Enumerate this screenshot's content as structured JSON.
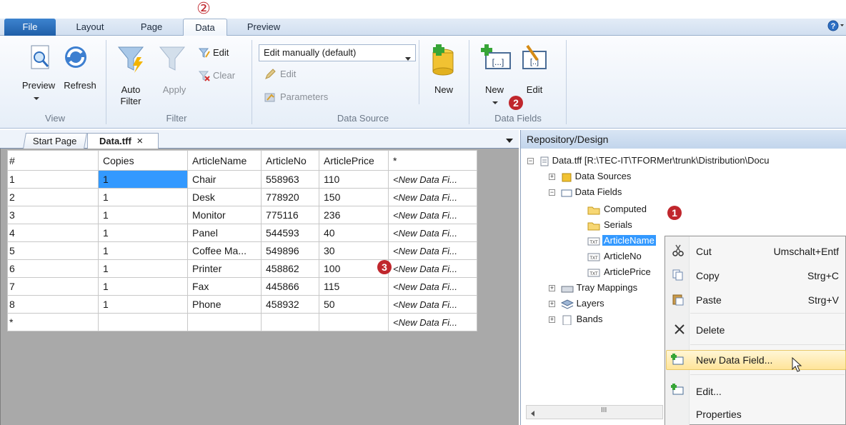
{
  "ribbon_tabs": {
    "file": "File",
    "layout": "Layout",
    "page": "Page",
    "data": "Data",
    "preview": "Preview"
  },
  "callouts": {
    "one": "1",
    "two": "2",
    "three": "3",
    "two_top": "②"
  },
  "groups": {
    "view": {
      "label": "View",
      "preview": "Preview",
      "refresh": "Refresh"
    },
    "filter": {
      "label": "Filter",
      "auto": "Auto",
      "auto2": "Filter",
      "apply": "Apply",
      "edit": "Edit",
      "clear": "Clear"
    },
    "datasource": {
      "label": "Data Source",
      "dropdown": "Edit manually (default)",
      "edit": "Edit",
      "parameters": "Parameters",
      "new": "New"
    },
    "datafields": {
      "label": "Data Fields",
      "new": "New",
      "edit": "Edit"
    }
  },
  "doc_tabs": {
    "start": "Start Page",
    "data": "Data.tff",
    "close": "×"
  },
  "grid": {
    "headers": [
      "#",
      "Copies",
      "ArticleName",
      "ArticleNo",
      "ArticlePrice",
      "*"
    ],
    "rows": [
      [
        "1",
        "1",
        "Chair",
        "558963",
        "110",
        "<New Data Fi..."
      ],
      [
        "2",
        "1",
        "Desk",
        "778920",
        "150",
        "<New Data Fi..."
      ],
      [
        "3",
        "1",
        "Monitor",
        "775116",
        "236",
        "<New Data Fi..."
      ],
      [
        "4",
        "1",
        "Panel",
        "544593",
        "40",
        "<New Data Fi..."
      ],
      [
        "5",
        "1",
        "Coffee Ma...",
        "549896",
        "30",
        "<New Data Fi..."
      ],
      [
        "6",
        "1",
        "Printer",
        "458862",
        "100",
        "<New Data Fi..."
      ],
      [
        "7",
        "1",
        "Fax",
        "445866",
        "115",
        "<New Data Fi..."
      ],
      [
        "8",
        "1",
        "Phone",
        "458932",
        "50",
        "<New Data Fi..."
      ],
      [
        "*",
        "",
        "",
        "",
        "",
        "<New Data Fi..."
      ]
    ]
  },
  "repository": {
    "title": "Repository/Design",
    "root": "Data.tff [R:\\TEC-IT\\TFORMer\\trunk\\Distribution\\Docu",
    "data_sources": "Data Sources",
    "data_fields": "Data Fields",
    "computed": "Computed",
    "serials": "Serials",
    "article_name": "ArticleName",
    "article_no": "ArticleNo",
    "article_price": "ArticlePrice",
    "tray_mappings": "Tray Mappings",
    "layers": "Layers",
    "bands": "Bands",
    "scroll_mid": "III"
  },
  "context_menu": {
    "cut": "Cut",
    "cut_sc": "Umschalt+Entf",
    "copy": "Copy",
    "copy_sc": "Strg+C",
    "paste": "Paste",
    "paste_sc": "Strg+V",
    "delete": "Delete",
    "new_field": "New Data Field...",
    "edit": "Edit...",
    "properties": "Properties"
  },
  "colors": {
    "accent": "#3399ff",
    "callout": "#c0272d",
    "file_tab": "#2a6cb8"
  }
}
